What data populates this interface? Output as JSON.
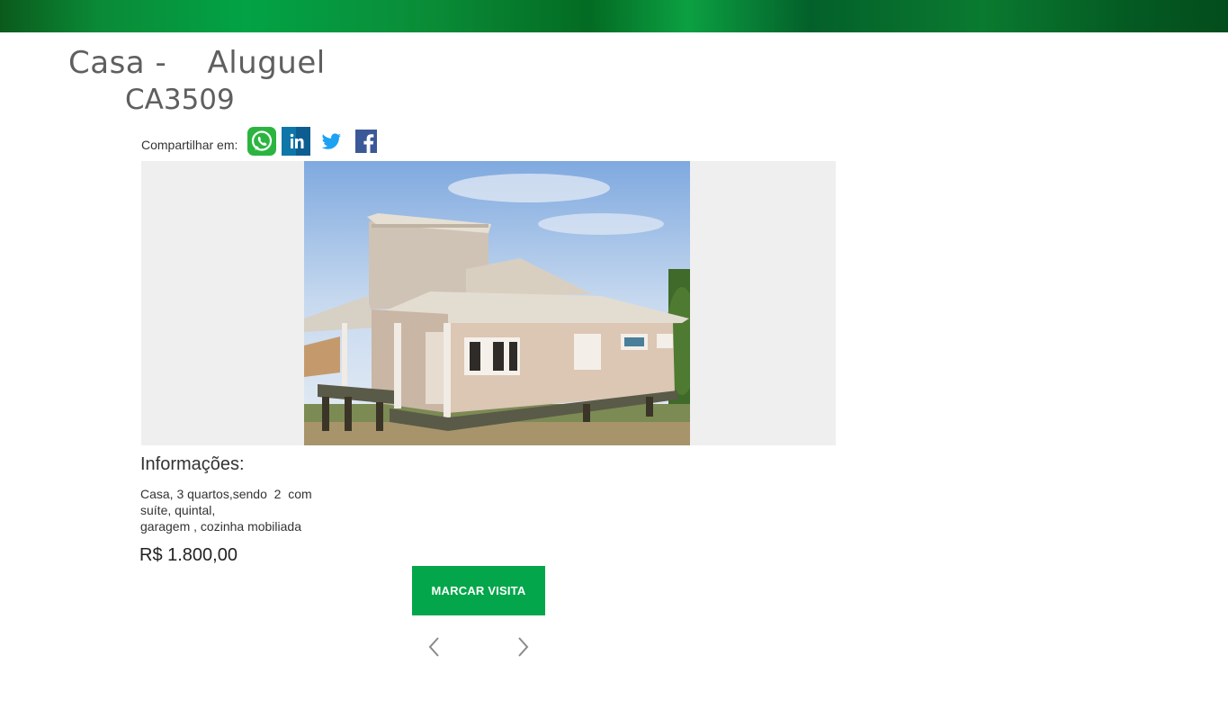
{
  "header": {
    "title_type": "Casa",
    "title_separator": "-",
    "title_status": "Aluguel",
    "code": "CA3509"
  },
  "share": {
    "label": "Compartilhar em:",
    "networks": [
      {
        "name": "whatsapp",
        "icon": "whatsapp-icon",
        "color": "#2bb540"
      },
      {
        "name": "linkedin",
        "icon": "linkedin-icon",
        "color": "#0e76a8"
      },
      {
        "name": "twitter",
        "icon": "twitter-icon",
        "color": "#1da1f2"
      },
      {
        "name": "facebook",
        "icon": "facebook-icon",
        "color": "#3b5998"
      }
    ]
  },
  "details": {
    "heading": "Informações:",
    "description_lines": [
      "Casa, 3 quartos,sendo  2  com",
      "suíte, quintal,",
      "garagem , cozinha mobiliada"
    ],
    "price": "R$ 1.800,00"
  },
  "actions": {
    "visit_label": "MARCAR VISITA"
  },
  "colors": {
    "accent": "#03a64a",
    "header_green": "#02a345"
  }
}
